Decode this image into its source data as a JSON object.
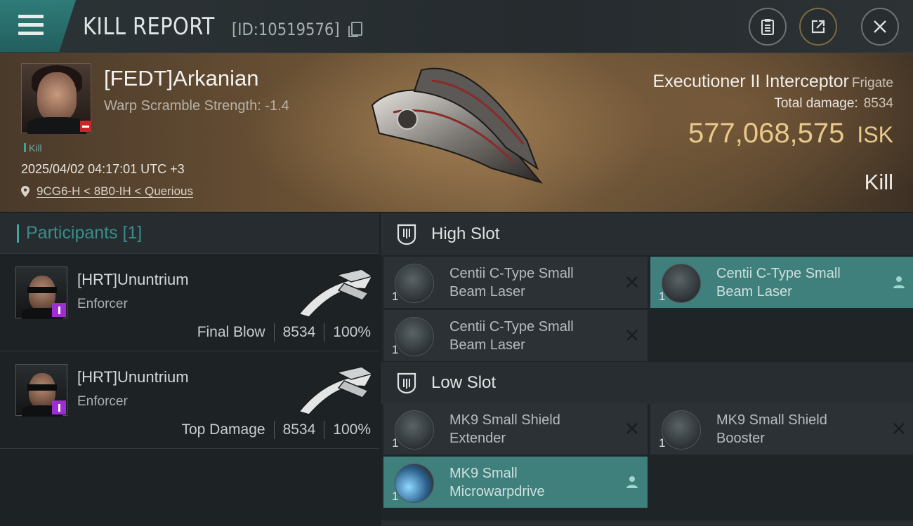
{
  "header": {
    "title": "KILL REPORT",
    "report_id": "[ID:10519576]",
    "buttons": [
      "clipboard-icon",
      "share-icon",
      "close-icon"
    ]
  },
  "victim": {
    "name": "[FEDT]Arkanian",
    "warp_scramble": "Warp Scramble Strength: -1.4",
    "tag": "Kill",
    "datetime": "2025/04/02 04:17:01 UTC +3",
    "location": "9CG6-H < 8B0-IH < Querious",
    "ship_name": "Executioner II Interceptor",
    "ship_class": "Frigate",
    "total_damage_label": "Total damage:",
    "total_damage_value": "8534",
    "isk_value": "577,068,575",
    "isk_unit": "ISK",
    "result": "Kill"
  },
  "participants": {
    "header": "Participants [1]",
    "rows": [
      {
        "name": "[HRT]Ununtrium",
        "ship": "Enforcer",
        "stat_label": "Final Blow",
        "damage": "8534",
        "percent": "100%"
      },
      {
        "name": "[HRT]Ununtrium",
        "ship": "Enforcer",
        "stat_label": "Top Damage",
        "damage": "8534",
        "percent": "100%"
      }
    ]
  },
  "fitting": {
    "high_slot": {
      "label": "High Slot",
      "modules": [
        {
          "qty": "1",
          "line1": "Centii C-Type Small",
          "line2": "Beam Laser",
          "status": "destroyed",
          "action_icon": "close-x-icon"
        },
        {
          "qty": "1",
          "line1": "Centii C-Type Small",
          "line2": "Beam Laser",
          "status": "dropped",
          "action_icon": "person-icon"
        },
        {
          "qty": "1",
          "line1": "Centii C-Type Small",
          "line2": "Beam Laser",
          "status": "destroyed",
          "action_icon": "close-x-icon"
        }
      ]
    },
    "low_slot": {
      "label": "Low Slot",
      "modules": [
        {
          "qty": "1",
          "line1": "MK9 Small Shield",
          "line2": "Extender",
          "status": "destroyed",
          "action_icon": "close-x-icon"
        },
        {
          "qty": "1",
          "line1": "MK9 Small Shield",
          "line2": "Booster",
          "status": "destroyed",
          "action_icon": "close-x-icon"
        },
        {
          "qty": "1",
          "line1": "MK9 Small",
          "line2": "Microwarpdrive",
          "status": "dropped",
          "action_icon": "person-icon"
        }
      ]
    }
  },
  "colors": {
    "accent_teal": "#3f7f7c",
    "isk_gold": "#e8c98a",
    "menu_teal": "#2f7c7a",
    "badge_purple": "#9b2fd0",
    "badge_red": "#c9262a"
  }
}
